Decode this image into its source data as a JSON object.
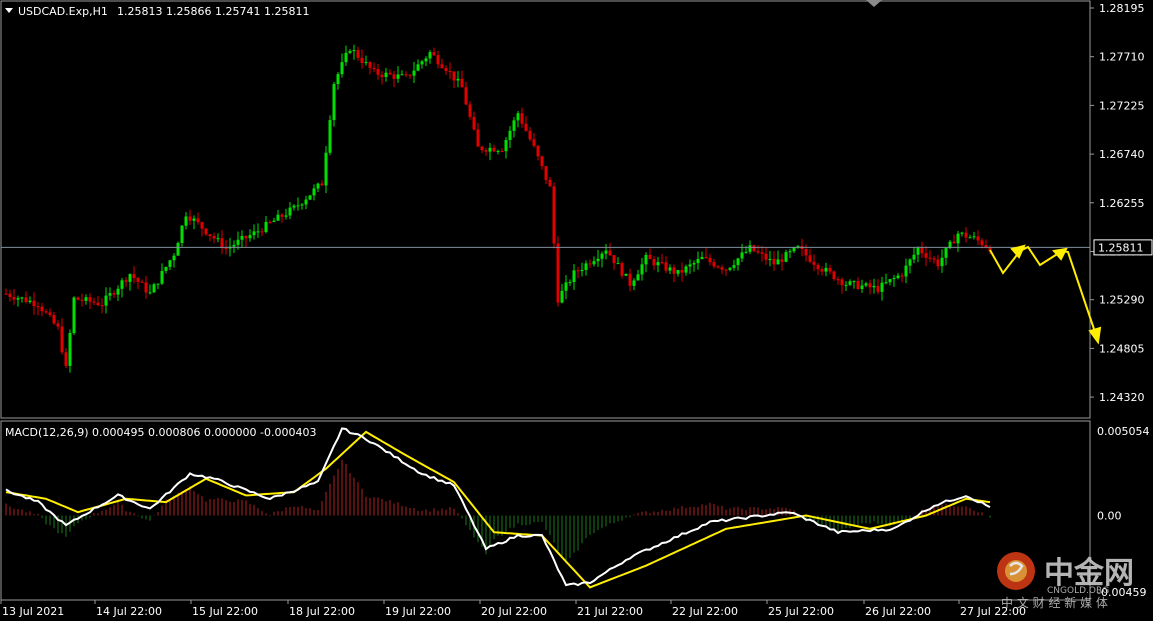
{
  "header": {
    "symbol_timeframe": "USDCAD.Exp,H1",
    "ohlc": "1.25813 1.25866 1.25741 1.25811"
  },
  "price_axis": {
    "labels": [
      "1.28195",
      "1.27710",
      "1.27225",
      "1.26740",
      "1.26255",
      "1.25770",
      "1.25290",
      "1.24805",
      "1.24320"
    ],
    "current_price_label": "1.25811"
  },
  "macd_panel": {
    "title": "MACD(12,26,9) 0.000495 0.000806 0.000000 -0.000403",
    "labels": [
      "0.005054",
      "0.00",
      "-0.00459"
    ]
  },
  "time_axis": {
    "labels": [
      "13 Jul 2021",
      "14 Jul 22:00",
      "15 Jul 22:00",
      "18 Jul 22:00",
      "19 Jul 22:00",
      "20 Jul 22:00",
      "21 Jul 22:00",
      "22 Jul 22:00",
      "25 Jul 22:00",
      "26 Jul 22:00",
      "27 Jul 22:00"
    ]
  },
  "watermark": {
    "name": "中金网",
    "domain": "CNGOLD.ORG",
    "slogan": "中 文 财 经 新 媒 体"
  },
  "colors": {
    "background": "#000000",
    "bull_candle": "#00e000",
    "bear_candle": "#e00000",
    "macd_main": "#ffffff",
    "macd_signal": "#ffee00",
    "histogram_positive": "#b02020",
    "histogram_negative": "#1a7a1a",
    "forecast_arrows": "#ffee00",
    "grid_border": "#9a9a9a",
    "price_line": "#8090a0"
  },
  "chart_data": [
    {
      "type": "candlestick",
      "instrument": "USDCAD.Exp",
      "timeframe": "H1",
      "ylim": [
        1.2416,
        1.2835
      ],
      "last_price": 1.25811,
      "anchors": [
        {
          "i": 0,
          "v": 1.2535
        },
        {
          "i": 8,
          "v": 1.2525
        },
        {
          "i": 13,
          "v": 1.25
        },
        {
          "i": 15,
          "v": 1.246
        },
        {
          "i": 17,
          "v": 1.253
        },
        {
          "i": 24,
          "v": 1.2525
        },
        {
          "i": 31,
          "v": 1.2555
        },
        {
          "i": 36,
          "v": 1.2535
        },
        {
          "i": 42,
          "v": 1.2575
        },
        {
          "i": 45,
          "v": 1.2615
        },
        {
          "i": 55,
          "v": 1.258
        },
        {
          "i": 62,
          "v": 1.2595
        },
        {
          "i": 72,
          "v": 1.262
        },
        {
          "i": 79,
          "v": 1.2645
        },
        {
          "i": 82,
          "v": 1.2745
        },
        {
          "i": 86,
          "v": 1.278
        },
        {
          "i": 92,
          "v": 1.2755
        },
        {
          "i": 100,
          "v": 1.275
        },
        {
          "i": 106,
          "v": 1.2775
        },
        {
          "i": 110,
          "v": 1.276
        },
        {
          "i": 114,
          "v": 1.274
        },
        {
          "i": 118,
          "v": 1.268
        },
        {
          "i": 124,
          "v": 1.268
        },
        {
          "i": 128,
          "v": 1.2715
        },
        {
          "i": 132,
          "v": 1.268
        },
        {
          "i": 136,
          "v": 1.264
        },
        {
          "i": 138,
          "v": 1.253
        },
        {
          "i": 142,
          "v": 1.2555
        },
        {
          "i": 150,
          "v": 1.258
        },
        {
          "i": 156,
          "v": 1.2545
        },
        {
          "i": 160,
          "v": 1.257
        },
        {
          "i": 168,
          "v": 1.2555
        },
        {
          "i": 174,
          "v": 1.257
        },
        {
          "i": 180,
          "v": 1.256
        },
        {
          "i": 186,
          "v": 1.258
        },
        {
          "i": 192,
          "v": 1.2565
        },
        {
          "i": 198,
          "v": 1.258
        },
        {
          "i": 204,
          "v": 1.256
        },
        {
          "i": 210,
          "v": 1.2545
        },
        {
          "i": 218,
          "v": 1.254
        },
        {
          "i": 224,
          "v": 1.2555
        },
        {
          "i": 228,
          "v": 1.258
        },
        {
          "i": 233,
          "v": 1.2565
        },
        {
          "i": 238,
          "v": 1.2595
        },
        {
          "i": 242,
          "v": 1.259
        },
        {
          "i": 246,
          "v": 1.2581
        }
      ]
    },
    {
      "type": "line",
      "name": "MACD(12,26,9)",
      "values": {
        "main": 0.000495,
        "signal": 0.000806,
        "third": 0.0,
        "fourth": -0.000403
      },
      "ylim": [
        -0.0051,
        0.0051
      ],
      "main_anchors": [
        {
          "i": 0,
          "v": 0.0015
        },
        {
          "i": 8,
          "v": 0.0008
        },
        {
          "i": 15,
          "v": -0.0006
        },
        {
          "i": 22,
          "v": 0.0004
        },
        {
          "i": 28,
          "v": 0.0012
        },
        {
          "i": 36,
          "v": 0.0004
        },
        {
          "i": 46,
          "v": 0.0025
        },
        {
          "i": 52,
          "v": 0.0022
        },
        {
          "i": 66,
          "v": 0.001
        },
        {
          "i": 78,
          "v": 0.002
        },
        {
          "i": 84,
          "v": 0.0052
        },
        {
          "i": 90,
          "v": 0.0046
        },
        {
          "i": 104,
          "v": 0.0025
        },
        {
          "i": 112,
          "v": 0.0018
        },
        {
          "i": 120,
          "v": -0.002
        },
        {
          "i": 128,
          "v": -0.0012
        },
        {
          "i": 134,
          "v": -0.0012
        },
        {
          "i": 140,
          "v": -0.0042
        },
        {
          "i": 146,
          "v": -0.004
        },
        {
          "i": 156,
          "v": -0.0025
        },
        {
          "i": 176,
          "v": -0.0004
        },
        {
          "i": 196,
          "v": 0.0002
        },
        {
          "i": 208,
          "v": -0.001
        },
        {
          "i": 222,
          "v": -0.0008
        },
        {
          "i": 232,
          "v": 0.0006
        },
        {
          "i": 240,
          "v": 0.0012
        },
        {
          "i": 246,
          "v": 0.0005
        }
      ],
      "signal_anchors": [
        {
          "i": 0,
          "v": 0.0014
        },
        {
          "i": 10,
          "v": 0.001
        },
        {
          "i": 18,
          "v": 0.0002
        },
        {
          "i": 30,
          "v": 0.001
        },
        {
          "i": 40,
          "v": 0.0008
        },
        {
          "i": 50,
          "v": 0.0022
        },
        {
          "i": 60,
          "v": 0.0012
        },
        {
          "i": 72,
          "v": 0.0014
        },
        {
          "i": 80,
          "v": 0.0028
        },
        {
          "i": 90,
          "v": 0.005
        },
        {
          "i": 100,
          "v": 0.0036
        },
        {
          "i": 112,
          "v": 0.002
        },
        {
          "i": 122,
          "v": -0.001
        },
        {
          "i": 134,
          "v": -0.0012
        },
        {
          "i": 146,
          "v": -0.0043
        },
        {
          "i": 160,
          "v": -0.003
        },
        {
          "i": 180,
          "v": -0.0008
        },
        {
          "i": 200,
          "v": 0.0
        },
        {
          "i": 216,
          "v": -0.0008
        },
        {
          "i": 230,
          "v": 0.0
        },
        {
          "i": 240,
          "v": 0.001
        },
        {
          "i": 246,
          "v": 0.0008
        }
      ]
    }
  ]
}
